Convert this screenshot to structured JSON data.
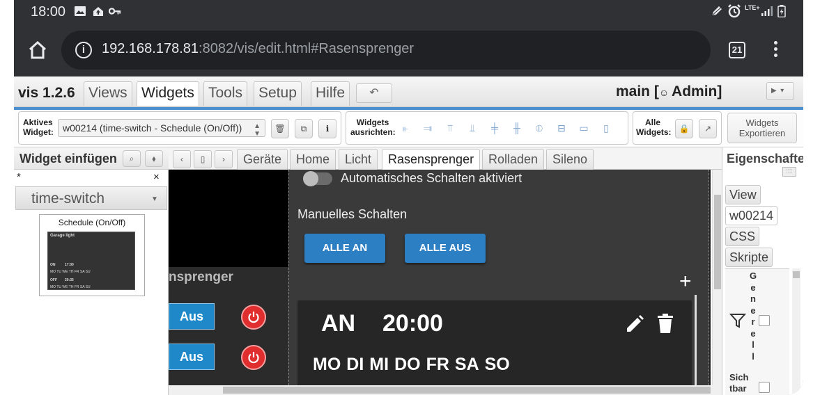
{
  "statusbar": {
    "time": "18:00",
    "left_icons": [
      "image-icon",
      "cloud-upload-icon",
      "key-icon"
    ],
    "right_icons": [
      "pen-icon",
      "alarm-icon",
      "lte-signal-icon",
      "signal-icon",
      "battery-icon"
    ],
    "lte_label": "LTE+"
  },
  "browser": {
    "url_host": "192.168.178.81",
    "url_rest": ":8082/vis/edit.html#Rasensprenger",
    "tab_count": "21"
  },
  "app": {
    "title": "vis 1.2.6",
    "menu_tabs": [
      "Views",
      "Widgets",
      "Tools",
      "Setup",
      "Hilfe"
    ],
    "active_menu": "Widgets",
    "undo_symbol": "↶",
    "view_name": "main [",
    "user": "Admin]",
    "accent_color": "#4c8fd0"
  },
  "toolbar": {
    "active_widget_label_1": "Aktives",
    "active_widget_label_2": "Widget:",
    "active_widget_value": "w00214 (time-switch - Schedule (On/Off))",
    "align_label_1": "Widgets",
    "align_label_2": "ausrichten:",
    "all_widgets_label_1": "Alle",
    "all_widgets_label_2": "Widgets:",
    "export_label_1": "Widgets",
    "export_label_2": "Exportieren"
  },
  "left_panel": {
    "title": "Widget einfügen",
    "filter_text": "*",
    "clear_symbol": "×",
    "category": "time-switch",
    "widget_name": "Schedule (On/Off)",
    "preview": {
      "title": "Garage light",
      "row1_state": "ON",
      "row1_time": "17:00",
      "row1_days": "MO TU WE TH FR SA SU",
      "row2_state": "OFF",
      "row2_time": "20:35",
      "row2_days": "MO TU WE TH FR SA SU"
    }
  },
  "view_tabs": {
    "items": [
      "Geräte",
      "Home",
      "Licht",
      "Rasensprenger",
      "Rolladen",
      "Sileno"
    ],
    "active": "Rasensprenger"
  },
  "canvas": {
    "room_title": "nsprenger",
    "aus_label": "Aus",
    "switch_widget": {
      "auto_label": "Automatisches Schalten aktiviert",
      "manual_label": "Manuelles Schalten",
      "all_on": "ALLE AN",
      "all_off": "ALLE AUS",
      "plus": "+",
      "schedule": {
        "state": "AN",
        "time": "20:00",
        "days": [
          "MO",
          "DI",
          "MI",
          "DO",
          "FR",
          "SA",
          "SO"
        ]
      }
    },
    "button_color": "#2d7fc4",
    "power_color": "#e02d2d"
  },
  "right_panel": {
    "title": "Eigenschaften",
    "tabs": [
      "View",
      "w00214",
      "CSS",
      "Skripte"
    ],
    "active_tab": "w00214",
    "generell_letters": [
      "G",
      "e",
      "n",
      "e",
      "r",
      "e",
      "l",
      "l"
    ],
    "sichtbar_1": "Sich",
    "sichtbar_2": "tbar"
  }
}
